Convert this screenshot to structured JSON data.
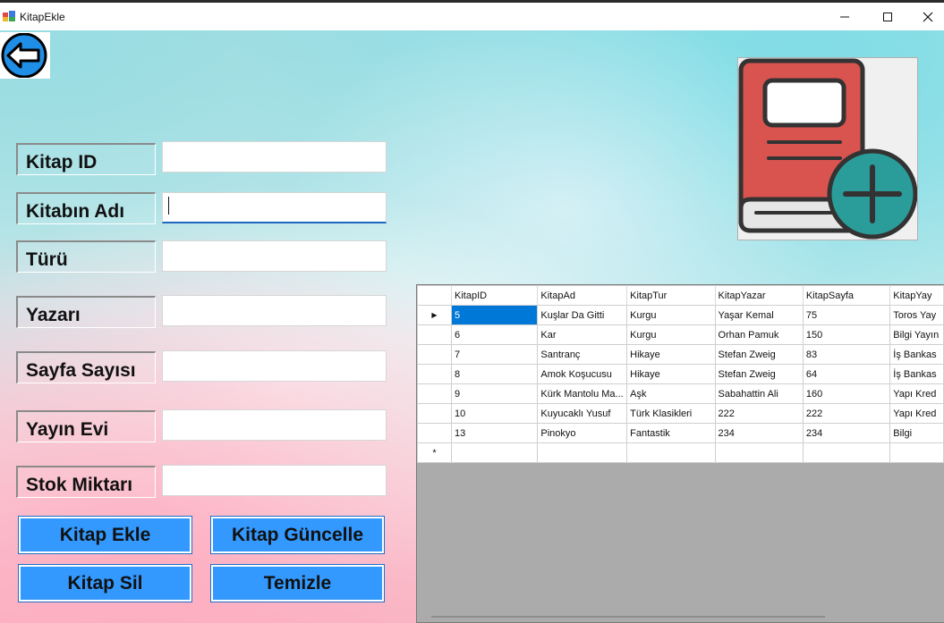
{
  "window": {
    "title": "KitapEkle",
    "controls": {
      "minimize": "─",
      "maximize": "☐",
      "close": "✕"
    }
  },
  "toolbar": {
    "back_icon": "back-arrow-icon"
  },
  "logo": {
    "icon": "book-add-icon",
    "colors": {
      "book": "#d9534f",
      "plus": "#2a9d9a",
      "outline": "#333333"
    }
  },
  "form": {
    "fields": [
      {
        "label": "Kitap ID",
        "value": ""
      },
      {
        "label": "Kitabın Adı",
        "value": ""
      },
      {
        "label": "Türü",
        "value": ""
      },
      {
        "label": "Yazarı",
        "value": ""
      },
      {
        "label": "Sayfa Sayısı",
        "value": ""
      },
      {
        "label": "Yayın Evi",
        "value": ""
      },
      {
        "label": "Stok Miktarı",
        "value": ""
      }
    ]
  },
  "buttons": {
    "add": "Kitap Ekle",
    "update": "Kitap Güncelle",
    "delete": "Kitap Sil",
    "clear": "Temizle",
    "color": "#3399ff"
  },
  "grid": {
    "columns": [
      "KitapID",
      "KitapAd",
      "KitapTur",
      "KitapYazar",
      "KitapSayfa",
      "KitapYay"
    ],
    "rows": [
      [
        "5",
        "Kuşlar Da Gitti",
        "Kurgu",
        "Yaşar Kemal",
        "75",
        "Toros Yay"
      ],
      [
        "6",
        "Kar",
        "Kurgu",
        "Orhan Pamuk",
        "150",
        "Bilgi Yayın"
      ],
      [
        "7",
        "Santranç",
        "Hikaye",
        "Stefan Zweig",
        "83",
        "İş Bankas"
      ],
      [
        "8",
        "Amok Koşucusu",
        "Hikaye",
        "Stefan Zweig",
        "64",
        "İş Bankas"
      ],
      [
        "9",
        "Kürk Mantolu Ma...",
        "Aşk",
        "Sabahattin Ali",
        "160",
        "Yapı Kred"
      ],
      [
        "10",
        "Kuyucaklı Yusuf",
        "Türk Klasikleri",
        "222",
        "222",
        "Yapı Kred"
      ],
      [
        "13",
        "Pinokyo",
        "Fantastik",
        "234",
        "234",
        "Bilgi"
      ]
    ],
    "current_row_marker": "▶",
    "new_row_marker": "*",
    "selection_color": "#0078d7"
  }
}
